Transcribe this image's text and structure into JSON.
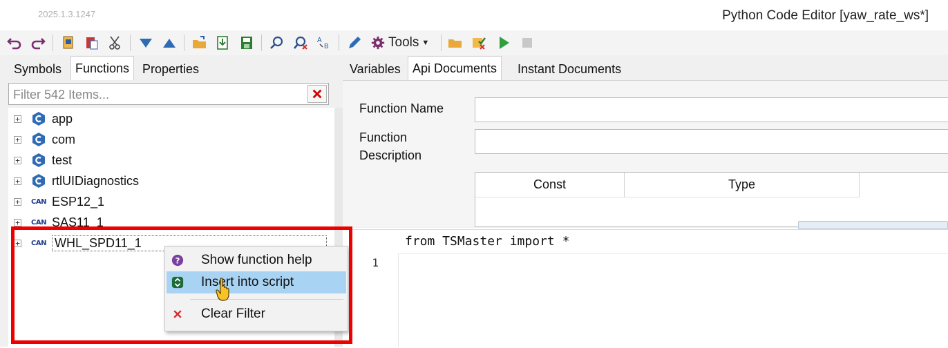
{
  "app": {
    "version": "2025.1.3.1247",
    "window_title": "Python Code Editor [yaw_rate_ws*]"
  },
  "toolbar": {
    "tools_label": "Tools"
  },
  "left_tabs": [
    {
      "label": "Symbols"
    },
    {
      "label": "Functions"
    },
    {
      "label": "Properties"
    }
  ],
  "filter": {
    "placeholder": "Filter 542 Items..."
  },
  "tree": [
    {
      "label": "app",
      "icon": "module-icon"
    },
    {
      "label": "com",
      "icon": "module-icon"
    },
    {
      "label": "test",
      "icon": "module-icon"
    },
    {
      "label": "rtlUIDiagnostics",
      "icon": "module-icon"
    },
    {
      "label": "ESP12_1",
      "icon": "can-icon"
    },
    {
      "label": "SAS11_1",
      "icon": "can-icon"
    },
    {
      "label": "WHL_SPD11_1",
      "icon": "can-icon"
    }
  ],
  "can_badge": "CAN",
  "right_tabs": [
    {
      "label": "Variables"
    },
    {
      "label": "Api Documents"
    },
    {
      "label": "Instant Documents"
    }
  ],
  "api_doc": {
    "function_name_label": "Function Name",
    "function_desc_label_1": "Function",
    "function_desc_label_2": "Description",
    "columns": [
      "Const",
      "Type"
    ]
  },
  "editor": {
    "import_line": "from TSMaster import *",
    "line_number": "1"
  },
  "context_menu": [
    {
      "label": "Show function help",
      "icon": "help-icon"
    },
    {
      "label": "Insert into script",
      "icon": "insert-icon"
    },
    {
      "label": "Clear Filter",
      "icon": "close-icon"
    }
  ],
  "colors": {
    "highlight": "#ee0000",
    "menu_hover": "#a9d3f2",
    "run_green": "#2e9e3e"
  }
}
